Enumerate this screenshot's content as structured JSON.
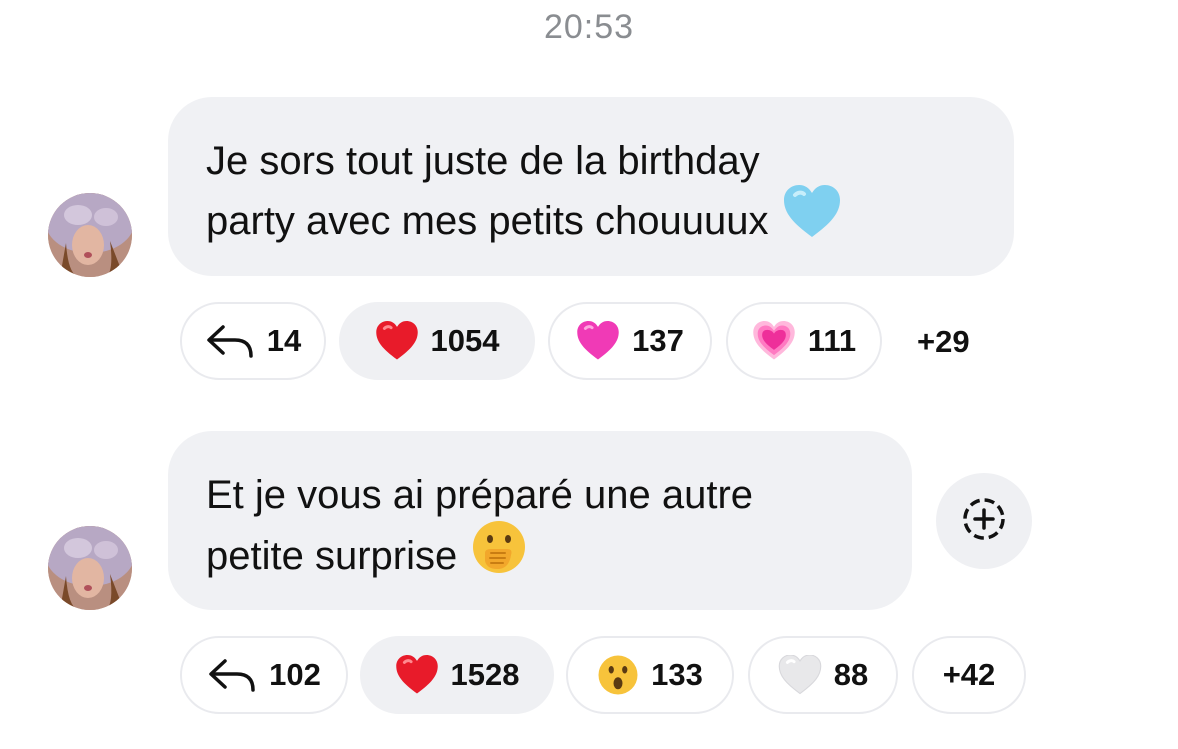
{
  "timestamp": "20:53",
  "messages": [
    {
      "lines": [
        "Je sors tout juste de la birthday",
        "party avec mes petits chouuuux"
      ],
      "emoji_icon": "light-blue-heart",
      "reactions": {
        "reply_count": "14",
        "items": [
          {
            "icon": "red-heart",
            "count": "1054",
            "active": true
          },
          {
            "icon": "pink-heart",
            "count": "137"
          },
          {
            "icon": "growing-heart",
            "count": "111"
          }
        ],
        "more": "+29"
      }
    },
    {
      "lines": [
        "Et je vous ai préparé une autre",
        "petite surprise"
      ],
      "emoji_icon": "face-with-hand-over-mouth",
      "reactions": {
        "reply_count": "102",
        "items": [
          {
            "icon": "red-heart",
            "count": "1528",
            "active": true
          },
          {
            "icon": "astonished-face",
            "count": "133"
          },
          {
            "icon": "white-heart",
            "count": "88"
          }
        ],
        "more": "+42"
      }
    }
  ],
  "colors": {
    "bubble_bg": "#f0f1f4",
    "timestamp": "#8a8d91",
    "pill_border": "#e9eaee"
  }
}
